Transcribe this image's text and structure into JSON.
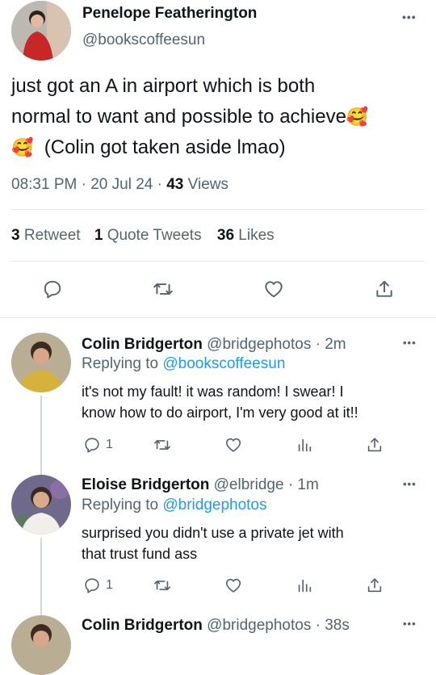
{
  "main_tweet": {
    "display_name": "Penelope Featherington",
    "handle": "@bookscoffeesun",
    "text_line1": "just got an A in airport which is both",
    "text_line2": "normal to want and possible to achieve",
    "text_line3": "(Colin got taken aside lmao)",
    "emoji": "🥰",
    "time": "08:31 PM",
    "date": "20 Jul 24",
    "views_count": "43",
    "views_label": "Views",
    "sep": "·",
    "retweets_count": "3",
    "retweets_label": "Retweet",
    "quotes_count": "1",
    "quotes_label": "Quote Tweets",
    "likes_count": "36",
    "likes_label": "Likes"
  },
  "replies": [
    {
      "display_name": "Colin Bridgerton",
      "handle": "@bridgephotos",
      "time": "· 2m",
      "replying_label": "Replying to",
      "replying_handle": "@bookscoffeesun",
      "text_line1": "it's not my fault! it was random! I swear! I",
      "text_line2": "know how to do airport, I'm very good at it!!",
      "reply_count": "1"
    },
    {
      "display_name": "Eloise Bridgerton",
      "handle": "@elbridge",
      "time": "· 1m",
      "replying_label": "Replying to",
      "replying_handle": "@bridgephotos",
      "text_line1": "surprised you didn't use a private jet with",
      "text_line2": "that trust fund ass",
      "reply_count": "1"
    },
    {
      "display_name": "Colin Bridgerton",
      "handle": "@bridgephotos",
      "time": "· 38s"
    }
  ],
  "more_glyph": "•••",
  "colors": {
    "accent": "#1d9bf0",
    "muted": "#536471",
    "text": "#0f1419",
    "divider": "#e7e9ea"
  },
  "icons": [
    "reply-icon",
    "retweet-icon",
    "like-icon",
    "share-icon",
    "analytics-icon",
    "more-icon"
  ]
}
